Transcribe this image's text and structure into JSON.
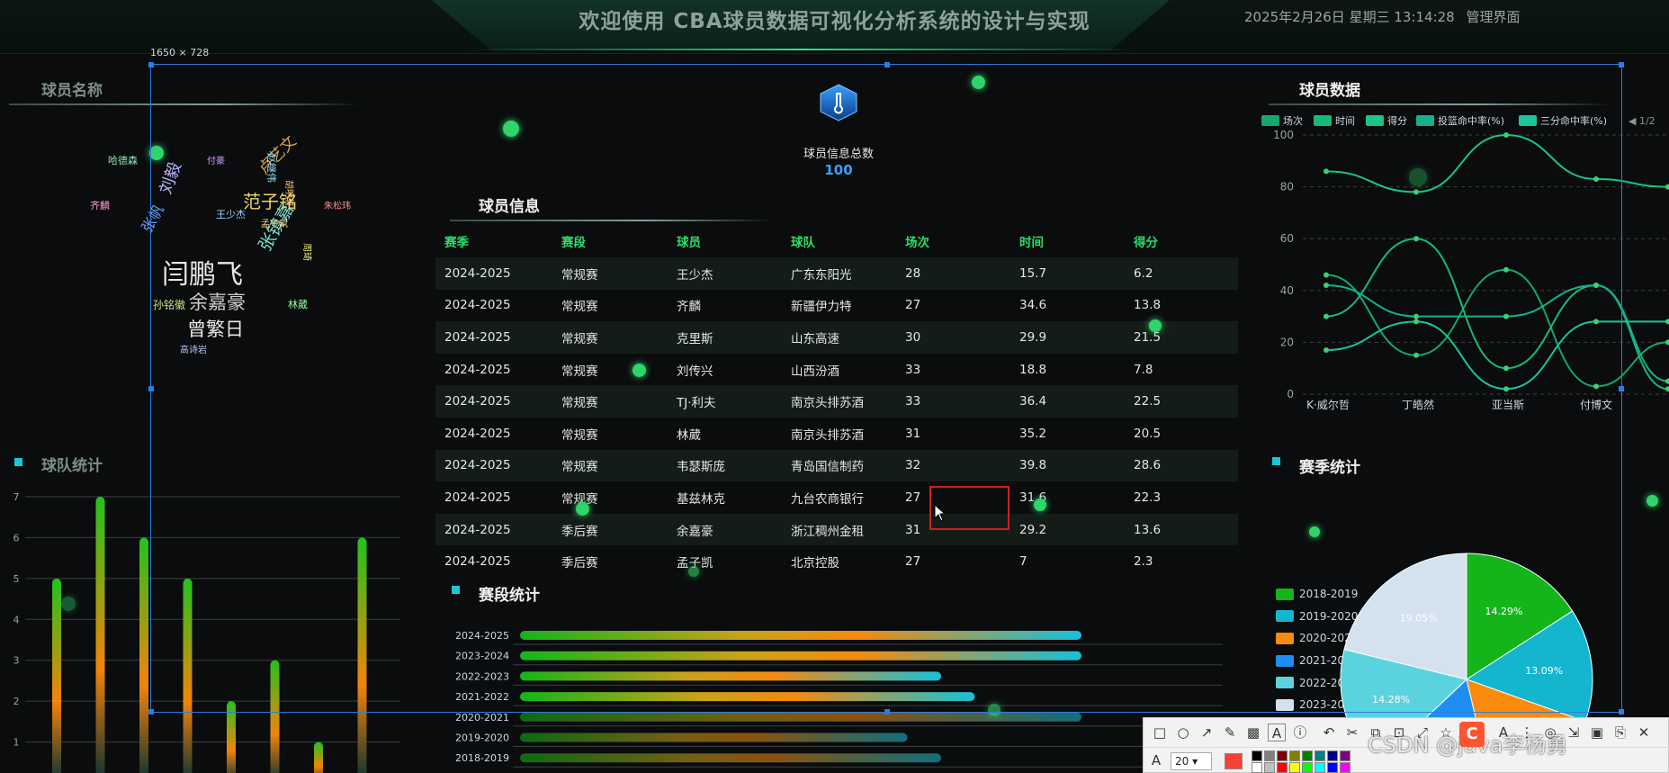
{
  "header": {
    "title": "欢迎使用 CBA球员数据可视化分析系统的设计与实现",
    "datetime": "2025年2月26日 星期三 13:14:28",
    "admin_link": "管理界面"
  },
  "selection": {
    "size_label": "1650 × 728"
  },
  "left": {
    "wordcloud_title": "球员名称",
    "wordcloud_words": [
      {
        "text": "闫鹏飞",
        "color": "#e8e8e8"
      },
      {
        "text": "余嘉豪",
        "color": "#cfcfcf"
      },
      {
        "text": "曾繁日",
        "color": "#e8e8e8"
      },
      {
        "text": "范子铭",
        "color": "#f0d468"
      },
      {
        "text": "张镇嘉",
        "color": "#7fe0d0"
      },
      {
        "text": "刘毅",
        "color": "#bdb8ff"
      },
      {
        "text": "卢艺文",
        "color": "#d9a64a"
      },
      {
        "text": "张帆",
        "color": "#6fa0ff"
      },
      {
        "text": "孙铭徽",
        "color": "#c6e08a"
      },
      {
        "text": "王少杰",
        "color": "#9ad0ff"
      },
      {
        "text": "齐麟",
        "color": "#ff9ad0"
      },
      {
        "text": "林葳",
        "color": "#9bffa8"
      },
      {
        "text": "孟子凯",
        "color": "#ffd28a"
      },
      {
        "text": "赵继伟",
        "color": "#a0e8ff"
      },
      {
        "text": "胡明轩",
        "color": "#ffc16b"
      },
      {
        "text": "付豪",
        "color": "#d8a4ff"
      },
      {
        "text": "哈德森",
        "color": "#8ee6b6"
      },
      {
        "text": "朱松玮",
        "color": "#ff8a8a"
      },
      {
        "text": "高诗岩",
        "color": "#b8c8ff"
      },
      {
        "text": "周琦",
        "color": "#f6f08a"
      }
    ],
    "team_title": "球队统计",
    "team_chart": {
      "type": "bar",
      "ylim": [
        0,
        7
      ],
      "yticks": [
        "0",
        "1",
        "2",
        "3",
        "4",
        "5",
        "6",
        "7"
      ],
      "values": [
        5,
        7,
        6,
        5,
        2,
        3,
        1,
        6
      ]
    }
  },
  "center": {
    "total_label": "球员信息总数",
    "total_value": "100",
    "table_title": "球员信息",
    "columns": [
      "赛季",
      "赛段",
      "球员",
      "球队",
      "场次",
      "时间",
      "得分"
    ],
    "rows": [
      [
        "2024-2025",
        "常规赛",
        "王少杰",
        "广东东阳光",
        "28",
        "15.7",
        "6.2"
      ],
      [
        "2024-2025",
        "常规赛",
        "齐麟",
        "新疆伊力特",
        "27",
        "34.6",
        "13.8"
      ],
      [
        "2024-2025",
        "常规赛",
        "克里斯",
        "山东高速",
        "30",
        "29.9",
        "21.5"
      ],
      [
        "2024-2025",
        "常规赛",
        "刘传兴",
        "山西汾酒",
        "33",
        "18.8",
        "7.8"
      ],
      [
        "2024-2025",
        "常规赛",
        "TJ·利夫",
        "南京头排苏酒",
        "33",
        "36.4",
        "22.5"
      ],
      [
        "2024-2025",
        "常规赛",
        "林葳",
        "南京头排苏酒",
        "31",
        "35.2",
        "20.5"
      ],
      [
        "2024-2025",
        "常规赛",
        "韦瑟斯庞",
        "青岛国信制药",
        "32",
        "39.8",
        "28.6"
      ],
      [
        "2024-2025",
        "常规赛",
        "基兹林克",
        "九台农商银行",
        "27",
        "31.6",
        "22.3"
      ],
      [
        "2024-2025",
        "季后赛",
        "余嘉豪",
        "浙江稠州金租",
        "31",
        "29.2",
        "13.6"
      ],
      [
        "2024-2025",
        "季后赛",
        "孟子凯",
        "北京控股",
        "27",
        "7",
        "2.3"
      ]
    ],
    "stage_title": "赛段统计",
    "stage_chart": {
      "type": "bar",
      "orientation": "horizontal",
      "categories": [
        "2024-2025",
        "2023-2024",
        "2022-2023",
        "2021-2022",
        "2020-2021",
        "2019-2020",
        "2018-2019"
      ],
      "values": [
        100,
        100,
        75,
        81,
        100,
        69,
        75
      ]
    }
  },
  "right": {
    "player_data_title": "球员数据",
    "legend": [
      "场次",
      "时间",
      "得分",
      "投篮命中率(%)",
      "三分命中率(%)"
    ],
    "legend_page": "1/2",
    "line_chart": {
      "type": "line",
      "ylim": [
        0,
        100
      ],
      "yticks": [
        "0",
        "20",
        "40",
        "60",
        "80",
        "100"
      ],
      "x": [
        "K·威尔哲",
        "丁皓然",
        "亚当斯",
        "付博文"
      ],
      "series": [
        {
          "name": "场次",
          "values": [
            46,
            15,
            48,
            3,
            20
          ]
        },
        {
          "name": "时间",
          "values": [
            30,
            60,
            10,
            42,
            2
          ]
        },
        {
          "name": "得分",
          "values": [
            86,
            78,
            100,
            83,
            80
          ]
        },
        {
          "name": "投篮命中率(%)",
          "values": [
            42,
            30,
            30,
            42,
            5
          ]
        },
        {
          "name": "三分命中率(%)",
          "values": [
            17,
            28,
            2,
            28,
            28
          ]
        }
      ]
    },
    "season_title": "赛季统计",
    "season_chart": {
      "type": "pie",
      "legend": [
        "2018-2019",
        "2019-2020",
        "2020-2021",
        "2021-2022",
        "2022-2023",
        "2023-2024"
      ],
      "legend_visible": [
        "2018-2019",
        "2019-2020",
        "2020-2021",
        "2021-202",
        "2022-202",
        "2023-202"
      ],
      "values": [
        14.29,
        13.09,
        14.29,
        15.0,
        14.28,
        19.05
      ],
      "labels": [
        "14.29%",
        "13.09%",
        "",
        "",
        "14.28%",
        "19.05%"
      ],
      "colors": [
        "#13b51a",
        "#13b5cf",
        "#fb8b0e",
        "#1e8ff0",
        "#5bd3de",
        "#d4e1ee"
      ]
    }
  },
  "toolbar": {
    "font_size": "20",
    "watermark": "CSDN @java李杨勇"
  }
}
